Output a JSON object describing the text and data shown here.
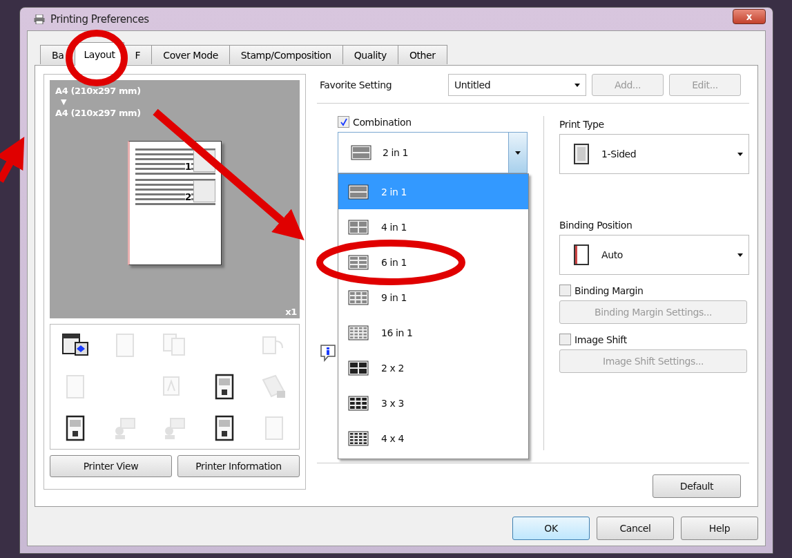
{
  "window": {
    "title": "Printing Preferences",
    "close": "x"
  },
  "tabs": [
    {
      "label": "Ba",
      "selected": false
    },
    {
      "label": "Layout",
      "selected": true
    },
    {
      "label": "F",
      "selected": false
    },
    {
      "label": "Cover Mode",
      "selected": false
    },
    {
      "label": "Stamp/Composition",
      "selected": false
    },
    {
      "label": "Quality",
      "selected": false
    },
    {
      "label": "Other",
      "selected": false
    }
  ],
  "preview": {
    "paper_from": "A4 (210x297 mm)",
    "arrow": "▼",
    "paper_to": "A4 (210x297 mm)",
    "page_numbers": [
      "1",
      "2"
    ],
    "copies": "x1"
  },
  "function_icons": [
    {
      "kind": "panel",
      "disabled": false
    },
    {
      "kind": "page",
      "disabled": true
    },
    {
      "kind": "copies",
      "disabled": true
    },
    {
      "kind": "blank"
    },
    {
      "kind": "rotate",
      "disabled": true
    },
    {
      "kind": "page",
      "disabled": true
    },
    {
      "kind": "blank"
    },
    {
      "kind": "font",
      "disabled": true
    },
    {
      "kind": "doc",
      "disabled": false
    },
    {
      "kind": "lock",
      "disabled": true
    },
    {
      "kind": "doc",
      "disabled": false
    },
    {
      "kind": "stamp",
      "disabled": true
    },
    {
      "kind": "stamp",
      "disabled": true
    },
    {
      "kind": "doc",
      "disabled": false
    },
    {
      "kind": "page",
      "disabled": true
    }
  ],
  "left_buttons": [
    "Printer View",
    "Printer Information"
  ],
  "favorite": {
    "label": "Favorite Setting",
    "value": "Untitled",
    "buttons": [
      {
        "label": "Add...",
        "disabled": true
      },
      {
        "label": "Edit...",
        "disabled": true
      }
    ]
  },
  "combination": {
    "label": "Combination",
    "checked": true,
    "value": "2 in 1",
    "options": [
      {
        "label": "2 in 1",
        "selected": true
      },
      {
        "label": "4 in 1",
        "selected": false
      },
      {
        "label": "6 in 1",
        "selected": false
      },
      {
        "label": "9 in 1",
        "selected": false
      },
      {
        "label": "16 in 1",
        "selected": false
      },
      {
        "label": "2 x 2",
        "selected": false
      },
      {
        "label": "3 x 3",
        "selected": false
      },
      {
        "label": "4 x 4",
        "selected": false
      }
    ]
  },
  "print_type": {
    "label": "Print Type",
    "value": "1-Sided"
  },
  "binding_position": {
    "label": "Binding Position",
    "value": "Auto"
  },
  "binding_margin": {
    "label": "Binding Margin",
    "checked": false,
    "button": "Binding Margin Settings..."
  },
  "image_shift": {
    "label": "Image Shift",
    "checked": false,
    "button": "Image Shift Settings..."
  },
  "default_button": "Default",
  "dialog_buttons": [
    {
      "label": "OK",
      "focused": true
    },
    {
      "label": "Cancel",
      "focused": false
    },
    {
      "label": "Help",
      "focused": false
    }
  ]
}
